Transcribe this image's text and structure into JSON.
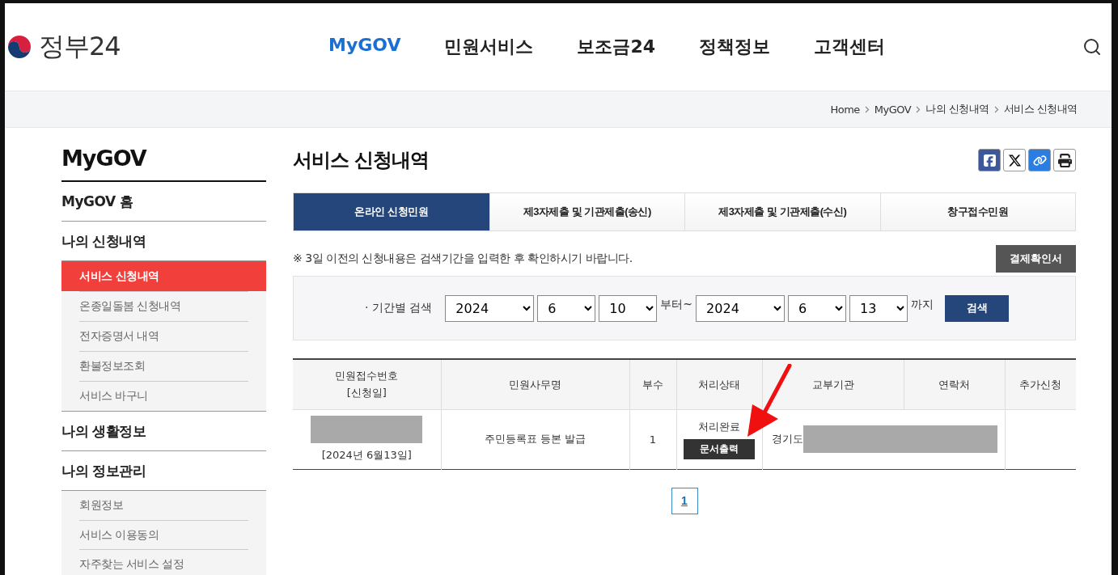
{
  "header": {
    "logo_text": "정부24",
    "nav": [
      {
        "label": "MyGOV",
        "selected": true
      },
      {
        "label": "민원서비스",
        "selected": false
      },
      {
        "label": "보조금24",
        "selected": false
      },
      {
        "label": "정책정보",
        "selected": false
      },
      {
        "label": "고객센터",
        "selected": false
      }
    ]
  },
  "breadcrumb": [
    "Home",
    "MyGOV",
    "나의 신청내역",
    "서비스 신청내역"
  ],
  "sidebar": {
    "title": "MyGOV",
    "sections": [
      {
        "label": "MyGOV 홈"
      },
      {
        "label": "나의 신청내역",
        "children": [
          {
            "label": "서비스 신청내역",
            "selected": true
          },
          {
            "label": "온종일돌봄 신청내역",
            "selected": false
          },
          {
            "label": "전자증명서 내역",
            "selected": false
          },
          {
            "label": "환불정보조회",
            "selected": false
          },
          {
            "label": "서비스 바구니",
            "selected": false
          }
        ]
      },
      {
        "label": "나의 생활정보"
      },
      {
        "label": "나의 정보관리",
        "children": [
          {
            "label": "회원정보",
            "selected": false
          },
          {
            "label": "서비스 이용동의",
            "selected": false
          },
          {
            "label": "자주찾는 서비스 설정",
            "selected": false
          }
        ]
      }
    ]
  },
  "page_title": "서비스 신청내역",
  "tabs": [
    {
      "label": "온라인 신청민원",
      "selected": true
    },
    {
      "label": "제3자제출 및 기관제출(송신)",
      "selected": false
    },
    {
      "label": "제3자제출 및 기관제출(수신)",
      "selected": false
    },
    {
      "label": "창구접수민원",
      "selected": false
    }
  ],
  "notice": "※ 3일 이전의 신청내용은 검색기간을 입력한 후 확인하시기 바랍니다.",
  "receipt_button": "결제확인서",
  "search": {
    "label": "· 기간별 검색",
    "from": [
      "2024",
      "6",
      "10"
    ],
    "from_suffix": "부터~",
    "to": [
      "2024",
      "6",
      "13"
    ],
    "to_suffix": "까지",
    "button": "검색"
  },
  "table": {
    "columns": [
      "민원접수번호\n[신청일]",
      "민원사무명",
      "부수",
      "처리상태",
      "교부기관",
      "연락처",
      "추가신청"
    ],
    "rows": [
      {
        "number_redacted": true,
        "date": "[2024년 6월13일]",
        "name": "주민등록표 등본 발급",
        "copies": "1",
        "status": "처리완료",
        "print_button": "문서출력",
        "agency": "경기도",
        "agency_redacted": true
      }
    ]
  },
  "pagination": [
    {
      "label": "1",
      "selected": true
    }
  ]
}
